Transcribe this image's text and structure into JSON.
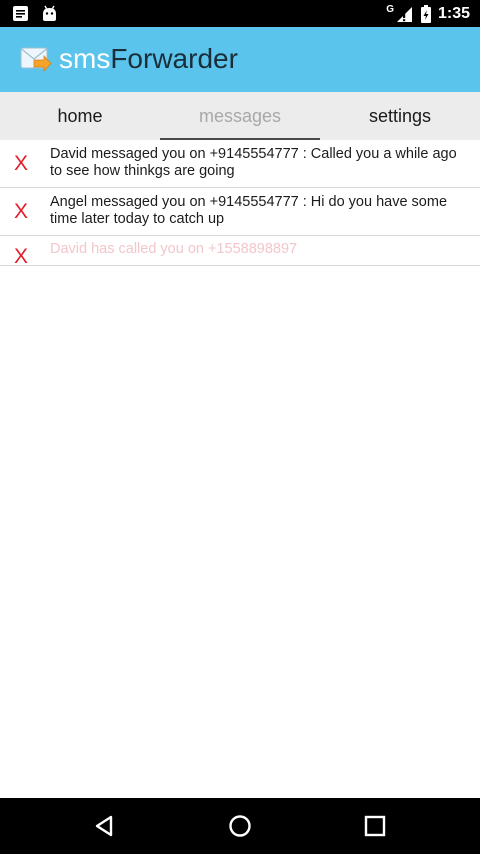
{
  "status_bar": {
    "time": "1:35",
    "network_label": "G",
    "icons": [
      "notification-icon",
      "android-debug-icon",
      "signal-icon",
      "battery-icon"
    ]
  },
  "app_bar": {
    "title_part1": "sms",
    "title_part2": "Forwarder",
    "logo_icon": "mail-forward-icon",
    "color": "#5bc4ec"
  },
  "tabs": [
    {
      "label": "home",
      "active": false
    },
    {
      "label": "messages",
      "active": true
    },
    {
      "label": "settings",
      "active": false
    }
  ],
  "messages": [
    {
      "delete_label": "X",
      "text": "David messaged you on +9145554777 : Called you a while ago to see how thinkgs are going"
    },
    {
      "delete_label": "X",
      "text": "Angel messaged you on +9145554777 : Hi do you have some time later today to catch up"
    },
    {
      "delete_label": "X",
      "text": "David has called you on +1558898897"
    }
  ],
  "nav_bar": {
    "icons": [
      "back-icon",
      "home-icon",
      "recents-icon"
    ]
  },
  "colors": {
    "delete": "#e21d2a",
    "tab_active_text": "#a8a8a8",
    "faded_message": "#f2c6cc"
  }
}
